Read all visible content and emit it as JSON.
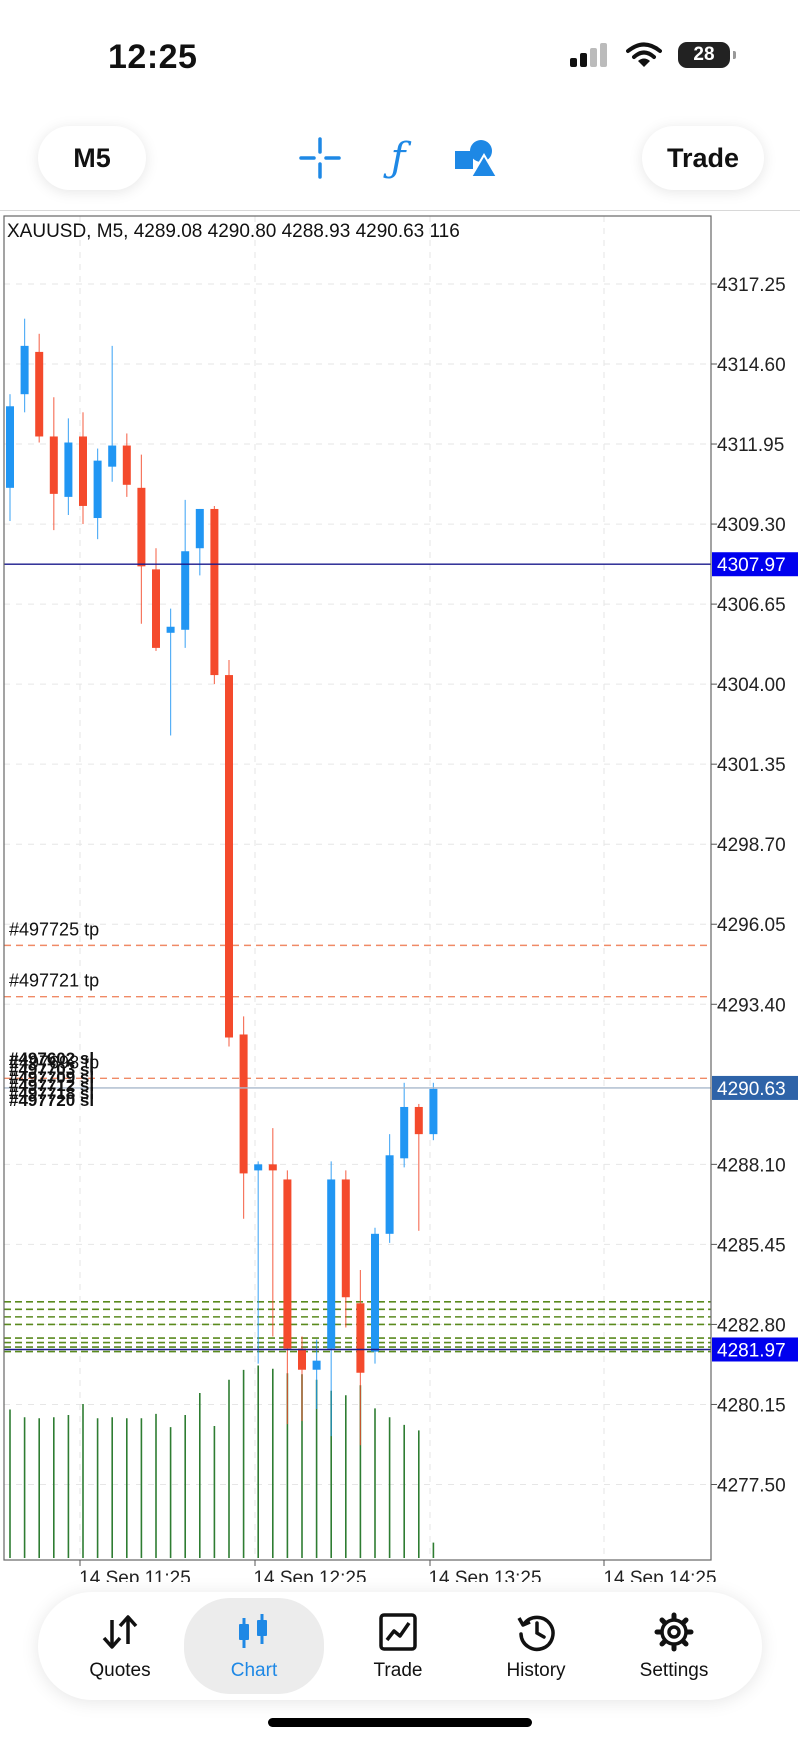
{
  "status": {
    "time": "12:25",
    "battery": "28"
  },
  "toolbar": {
    "timeframe": "M5",
    "trade": "Trade"
  },
  "chart_header": "XAUUSD, M5, 4289.08 4290.80 4288.93 4290.63 116",
  "colors": {
    "bull": "#2196f3",
    "bear": "#f44a2c",
    "volume": "#2e7d32",
    "accent": "#1e88e5",
    "price_tag_dark": "#0000ee",
    "price_tag_bid": "#2e63a8"
  },
  "price_axis": {
    "ticks": [
      "4317.25",
      "4314.60",
      "4311.95",
      "4309.30",
      "4306.65",
      "4304.00",
      "4301.35",
      "4298.70",
      "4296.05",
      "4293.40",
      "4288.10",
      "4285.45",
      "4282.80",
      "4280.15",
      "4277.50"
    ],
    "tags": [
      {
        "label": "4307.97",
        "price": 4307.97,
        "kind": "line"
      },
      {
        "label": "4290.63",
        "price": 4290.63,
        "kind": "bid"
      },
      {
        "label": "4281.97",
        "price": 4281.97,
        "kind": "line"
      }
    ]
  },
  "time_axis": [
    "14 Sep 11:25",
    "14 Sep 12:25",
    "14 Sep 13:25",
    "14 Sep 14:25"
  ],
  "order_labels": {
    "tp": [
      "#497725 tp",
      "#497721 tp",
      "#497698 tp"
    ],
    "sl": [
      "#497602 sl",
      "#497703 sl",
      "#497709 sl",
      "#497712 sl",
      "#497718 sl",
      "#497720 sl"
    ]
  },
  "chart_data": {
    "type": "candlestick",
    "title": "XAUUSD, M5, 4289.08 4290.80 4288.93 4290.63 116",
    "symbol": "XAUUSD",
    "timeframe": "M5",
    "ylim": [
      4275.0,
      4319.5
    ],
    "candles": [
      {
        "o": 4310.5,
        "h": 4313.6,
        "l": 4309.4,
        "c": 4313.2
      },
      {
        "o": 4313.6,
        "h": 4316.1,
        "l": 4313.0,
        "c": 4315.2
      },
      {
        "o": 4315.0,
        "h": 4315.6,
        "l": 4312.0,
        "c": 4312.2
      },
      {
        "o": 4312.2,
        "h": 4313.5,
        "l": 4309.1,
        "c": 4310.3
      },
      {
        "o": 4310.2,
        "h": 4312.8,
        "l": 4309.6,
        "c": 4312.0
      },
      {
        "o": 4312.2,
        "h": 4313.0,
        "l": 4309.3,
        "c": 4309.9
      },
      {
        "o": 4309.5,
        "h": 4311.8,
        "l": 4308.8,
        "c": 4311.4
      },
      {
        "o": 4311.2,
        "h": 4315.2,
        "l": 4310.7,
        "c": 4311.9
      },
      {
        "o": 4311.9,
        "h": 4312.3,
        "l": 4310.2,
        "c": 4310.6
      },
      {
        "o": 4310.5,
        "h": 4311.6,
        "l": 4306.0,
        "c": 4307.9
      },
      {
        "o": 4307.8,
        "h": 4308.5,
        "l": 4305.1,
        "c": 4305.2
      },
      {
        "o": 4305.7,
        "h": 4306.5,
        "l": 4302.3,
        "c": 4305.9
      },
      {
        "o": 4305.8,
        "h": 4310.1,
        "l": 4305.2,
        "c": 4308.4
      },
      {
        "o": 4308.5,
        "h": 4309.8,
        "l": 4307.6,
        "c": 4309.8
      },
      {
        "o": 4309.8,
        "h": 4309.9,
        "l": 4304.0,
        "c": 4304.3
      },
      {
        "o": 4304.3,
        "h": 4304.8,
        "l": 4292.0,
        "c": 4292.3
      },
      {
        "o": 4292.4,
        "h": 4293.0,
        "l": 4286.3,
        "c": 4287.8
      },
      {
        "o": 4287.9,
        "h": 4288.2,
        "l": 4281.5,
        "c": 4288.1
      },
      {
        "o": 4288.1,
        "h": 4289.3,
        "l": 4282.4,
        "c": 4287.9
      },
      {
        "o": 4287.6,
        "h": 4287.9,
        "l": 4279.5,
        "c": 4282.0
      },
      {
        "o": 4282.0,
        "h": 4282.4,
        "l": 4279.6,
        "c": 4281.3
      },
      {
        "o": 4281.3,
        "h": 4282.3,
        "l": 4280.0,
        "c": 4281.6
      },
      {
        "o": 4282.0,
        "h": 4288.2,
        "l": 4279.1,
        "c": 4287.6
      },
      {
        "o": 4287.6,
        "h": 4287.9,
        "l": 4282.7,
        "c": 4283.7
      },
      {
        "o": 4283.5,
        "h": 4284.6,
        "l": 4278.8,
        "c": 4281.2
      },
      {
        "o": 4281.9,
        "h": 4286.0,
        "l": 4281.5,
        "c": 4285.8
      },
      {
        "o": 4285.8,
        "h": 4289.1,
        "l": 4285.5,
        "c": 4288.4
      },
      {
        "o": 4288.3,
        "h": 4290.8,
        "l": 4288.0,
        "c": 4290.0
      },
      {
        "o": 4290.0,
        "h": 4290.1,
        "l": 4285.9,
        "c": 4289.1
      },
      {
        "o": 4289.1,
        "h": 4290.8,
        "l": 4288.9,
        "c": 4290.6
      }
    ],
    "volume": [
      135,
      128,
      127,
      128,
      130,
      140,
      127,
      128,
      127,
      127,
      131,
      119,
      130,
      150,
      120,
      162,
      171,
      175,
      172,
      168,
      167,
      162,
      152,
      148,
      157,
      136,
      128,
      121,
      116,
      14
    ],
    "volume_max": 180,
    "levels": {
      "tp": [
        4295.35,
        4293.65,
        4290.95
      ],
      "sl": [
        4283.55,
        4283.3,
        4283.05,
        4282.8,
        4282.35,
        4282.2,
        4282.05,
        4281.9
      ]
    },
    "hlines": [
      4307.97,
      4281.97
    ],
    "bid": 4290.63
  },
  "nav": {
    "items": [
      {
        "label": "Quotes"
      },
      {
        "label": "Chart"
      },
      {
        "label": "Trade"
      },
      {
        "label": "History"
      },
      {
        "label": "Settings"
      }
    ]
  }
}
